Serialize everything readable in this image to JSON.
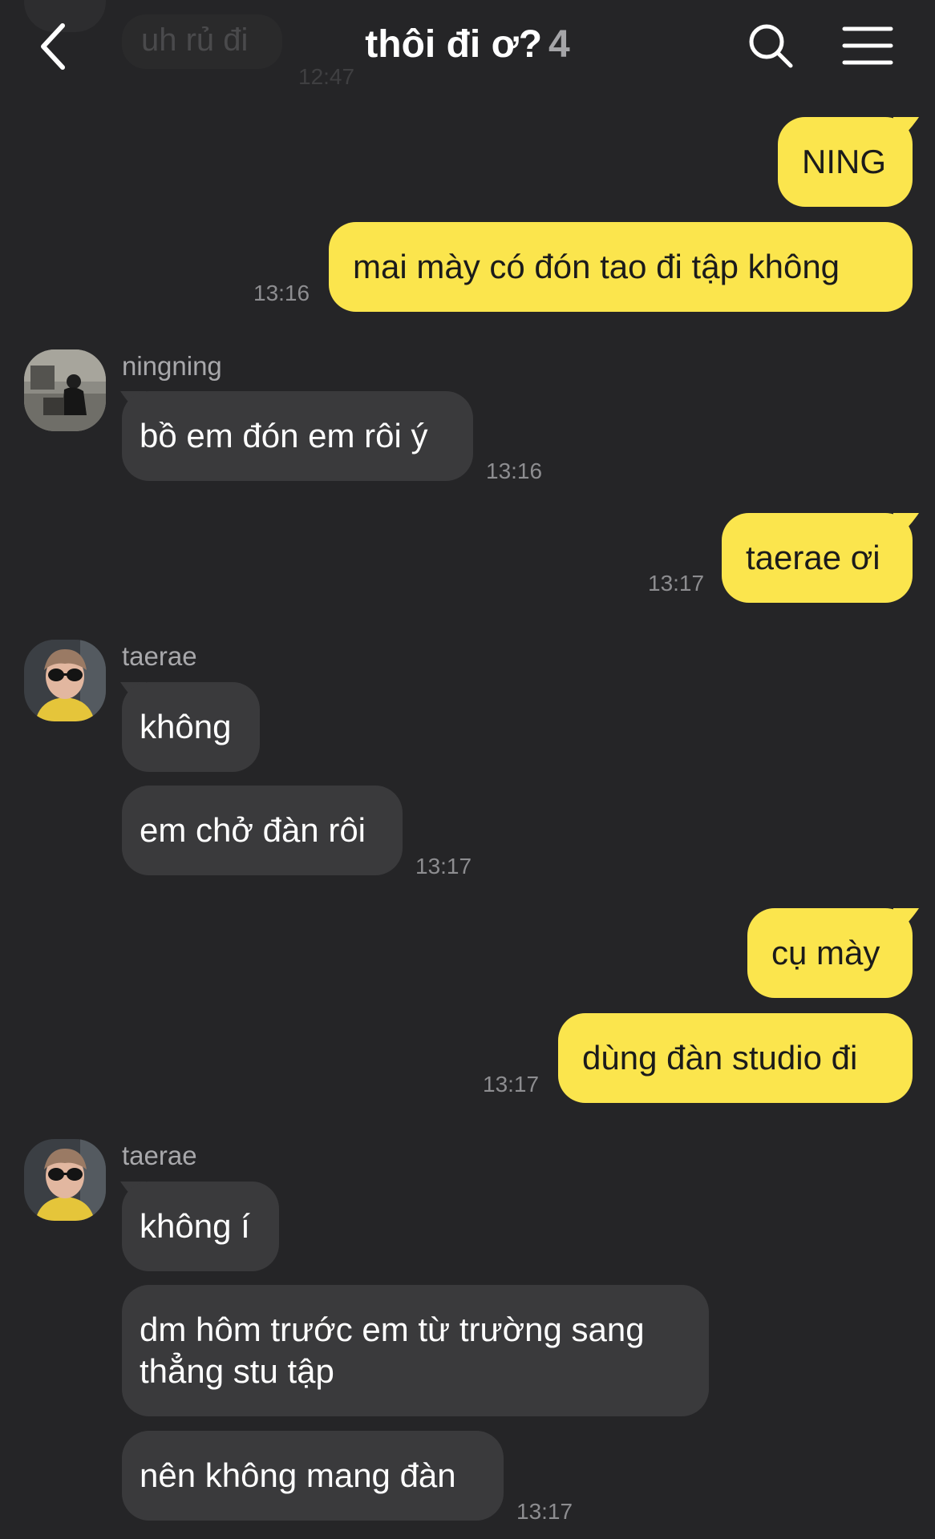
{
  "header": {
    "title": "thôi đi ơ?",
    "member_count": "4",
    "back_icon": "chevron-left-icon",
    "search_icon": "search-icon",
    "menu_icon": "hamburger-menu-icon"
  },
  "partial_message": {
    "text": "uh rủ đi",
    "time": "12:47"
  },
  "messages": {
    "m1": {
      "text": "NING"
    },
    "m2": {
      "text": "mai mày có đón tao đi tập không",
      "time": "13:16"
    },
    "m3_sender": "ningning",
    "m3": {
      "text": "bồ em đón em rôi ý",
      "time": "13:16"
    },
    "m4": {
      "text": "taerae ơi",
      "time": "13:17"
    },
    "m5_sender": "taerae",
    "m5": {
      "text": "không"
    },
    "m6": {
      "text": "em chở đàn rôi",
      "time": "13:17"
    },
    "m7": {
      "text": "cụ mày"
    },
    "m8": {
      "text": "dùng đàn studio đi",
      "time": "13:17"
    },
    "m9_sender": "taerae",
    "m9": {
      "text": "không í"
    },
    "m10": {
      "text": "dm hôm trước em từ trường sang thẳng stu tập"
    },
    "m11": {
      "text": "nên không mang đàn",
      "time": "13:17"
    }
  },
  "colors": {
    "background": "#252527",
    "outgoing_bubble": "#fbe54d",
    "incoming_bubble": "#3a3a3c"
  }
}
